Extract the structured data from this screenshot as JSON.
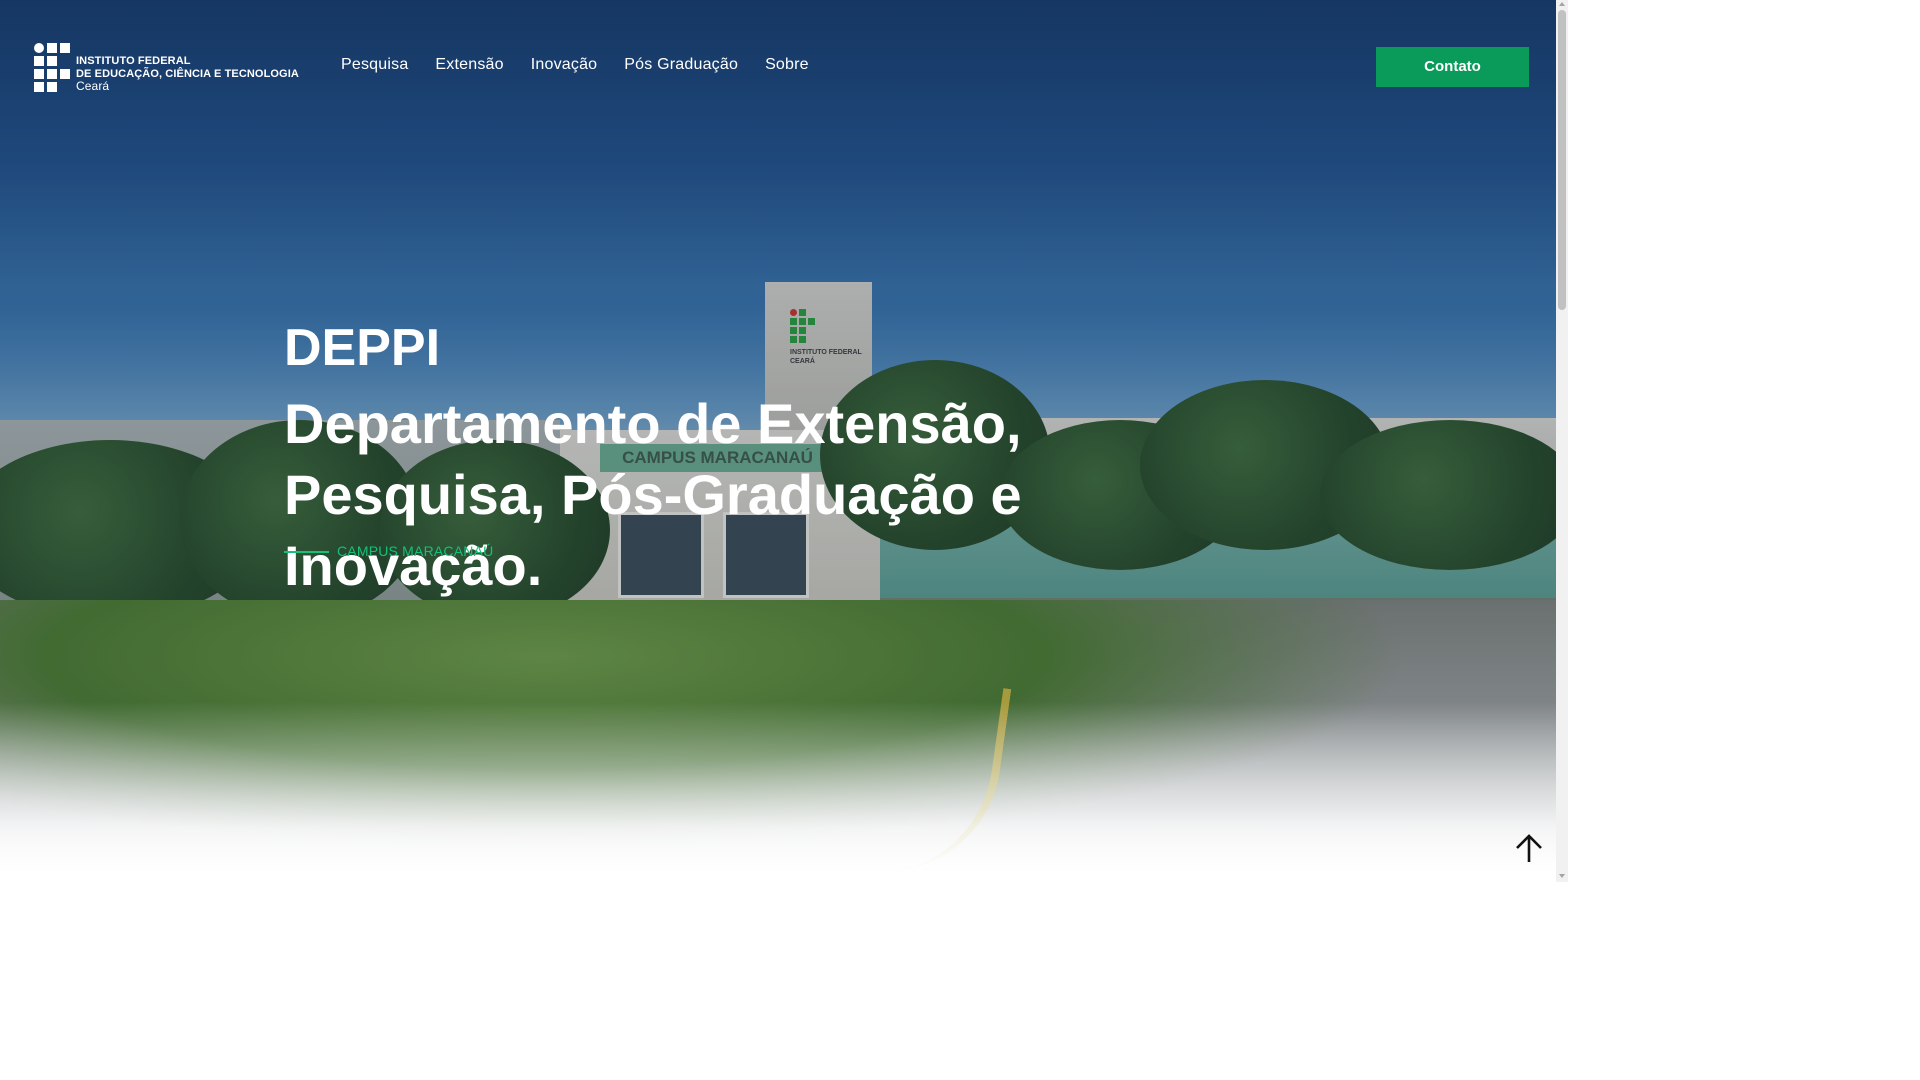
{
  "header": {
    "logo": {
      "line1": "INSTITUTO FEDERAL",
      "line2": "DE EDUCAÇÃO, CIÊNCIA E TECNOLOGIA",
      "line3": "Ceará"
    },
    "nav": [
      {
        "label": "Pesquisa"
      },
      {
        "label": "Extensão"
      },
      {
        "label": "Inovação"
      },
      {
        "label": "Pós Graduação"
      },
      {
        "label": "Sobre"
      }
    ],
    "contact_label": "Contato"
  },
  "hero": {
    "title": "DEPPI",
    "subtitle": "Departamento de Extensão, Pesquisa, Pós-Graduação e Inovação.",
    "campus": "CAMPUS MARACANAÚ",
    "photo_sign": "CAMPUS MARACANAÚ",
    "tower_text_1": "INSTITUTO FEDERAL",
    "tower_text_2": "CEARÁ"
  },
  "colors": {
    "accent_green": "#0a9b5a",
    "campus_green": "#12c27a",
    "header_blue": "#1d4d86"
  },
  "icons": {
    "back_to_top": "arrow-up-icon"
  }
}
